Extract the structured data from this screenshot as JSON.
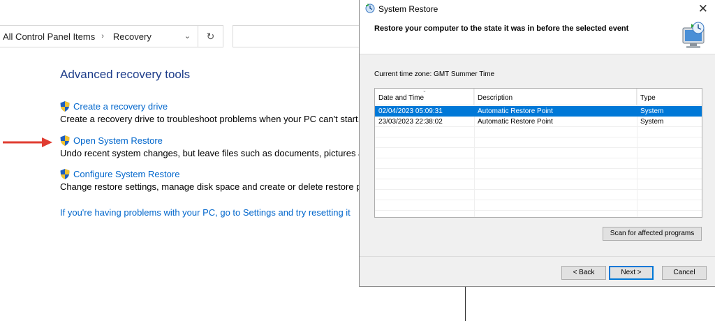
{
  "control_panel": {
    "breadcrumb": [
      "All Control Panel Items",
      "Recovery"
    ],
    "heading": "Advanced recovery tools",
    "items": [
      {
        "link": "Create a recovery drive",
        "description": "Create a recovery drive to troubleshoot problems when your PC can't start."
      },
      {
        "link": "Open System Restore",
        "description": "Undo recent system changes, but leave files such as documents, pictures and"
      },
      {
        "link": "Configure System Restore",
        "description": "Change restore settings, manage disk space and create or delete restore point"
      }
    ],
    "bottom_link": "If you're having problems with your PC, go to Settings and try resetting it",
    "icons": {
      "refresh": "refresh-icon",
      "dropdown": "chevron-down-icon",
      "shield": "uac-shield-icon",
      "arrow": "red-arrow-icon"
    },
    "colors": {
      "link": "#0066cc",
      "heading": "#1e3d8a",
      "arrow": "#e03c31"
    }
  },
  "dialog": {
    "title": "System Restore",
    "header": "Restore your computer to the state it was in before the selected event",
    "timezone": "Current time zone: GMT Summer Time",
    "columns": [
      "Date and Time",
      "Description",
      "Type"
    ],
    "rows": [
      {
        "date": "02/04/2023 05:09:31",
        "description": "Automatic Restore Point",
        "type": "System",
        "selected": true
      },
      {
        "date": "23/03/2023 22:38:02",
        "description": "Automatic Restore Point",
        "type": "System",
        "selected": false
      }
    ],
    "buttons": {
      "scan": "Scan for affected programs",
      "back": "< Back",
      "next": "Next >",
      "cancel": "Cancel"
    },
    "colors": {
      "selection": "#0078d7"
    }
  }
}
